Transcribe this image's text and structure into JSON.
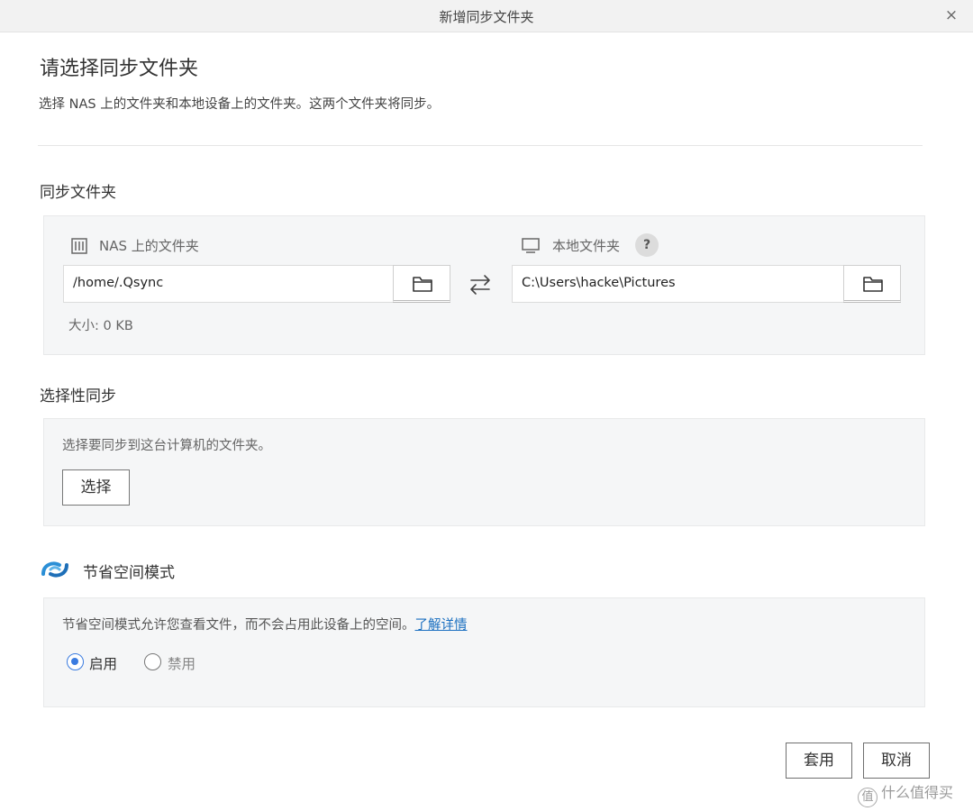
{
  "window": {
    "title": "新增同步文件夹",
    "close_glyph": "×"
  },
  "header": {
    "heading": "请选择同步文件夹",
    "subtitle": "选择 NAS 上的文件夹和本地设备上的文件夹。这两个文件夹将同步。"
  },
  "sync_folder": {
    "section_label": "同步文件夹",
    "nas": {
      "label": "NAS 上的文件夹",
      "path": "/home/.Qsync",
      "size_text": "大小: 0 KB"
    },
    "local": {
      "label": "本地文件夹",
      "help": "?",
      "path": "C:\\Users\\hacke\\Pictures"
    }
  },
  "selective_sync": {
    "section_label": "选择性同步",
    "description": "选择要同步到这台计算机的文件夹。",
    "select_button": "选择"
  },
  "space_saving": {
    "section_label": "节省空间模式",
    "description": "节省空间模式允许您查看文件，而不会占用此设备上的空间。",
    "learn_more": "了解详情",
    "enable_label": "启用",
    "disable_label": "禁用",
    "selected": "enable"
  },
  "footer": {
    "apply_button": "套用",
    "cancel_button": "取消"
  },
  "watermark": {
    "icon_glyph": "值",
    "text": "什么值得买"
  },
  "colors": {
    "accent": "#3a7be0",
    "link": "#1a6fc0",
    "panel_bg": "#f5f6f7"
  }
}
